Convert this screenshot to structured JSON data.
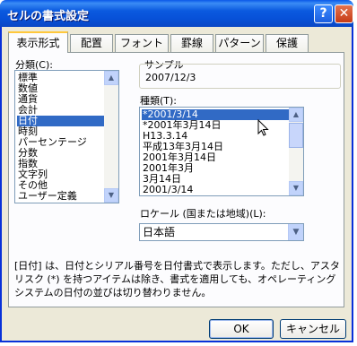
{
  "window": {
    "title": "セルの書式設定",
    "help_label": "?",
    "close_label": "✕"
  },
  "tabs": [
    {
      "label": "表示形式",
      "active": true
    },
    {
      "label": "配置"
    },
    {
      "label": "フォント"
    },
    {
      "label": "罫線"
    },
    {
      "label": "パターン"
    },
    {
      "label": "保護"
    }
  ],
  "category": {
    "label": "分類(C):",
    "items": [
      "標準",
      "数値",
      "通貨",
      "会計",
      "日付",
      "時刻",
      "パーセンテージ",
      "分数",
      "指数",
      "文字列",
      "その他",
      "ユーザー定義"
    ],
    "selected": "日付"
  },
  "sample": {
    "label": "サンプル",
    "value": "2007/12/3"
  },
  "type": {
    "label": "種類(T):",
    "items": [
      "*2001/3/14",
      "*2001年3月14日",
      "H13.3.14",
      "平成13年3月14日",
      "2001年3月14日",
      "2001年3月",
      "3月14日",
      "2001/3/14"
    ],
    "selected": "*2001/3/14"
  },
  "locale": {
    "label": "ロケール (国または地域)(L):",
    "value": "日本語"
  },
  "description": "[日付] は、日付とシリアル番号を日付書式で表示します。ただし、アスタリスク (*) を持つアイテムは除き、書式を適用しても、オペレーティング システムの日付の並びは切り替わりません。",
  "buttons": {
    "ok": "OK",
    "cancel": "キャンセル"
  },
  "icons": {
    "scroll_up": "scroll-up-arrow-icon",
    "scroll_down": "scroll-down-arrow-icon",
    "dropdown": "chevron-down-icon",
    "cursor": "mouse-pointer-icon"
  }
}
